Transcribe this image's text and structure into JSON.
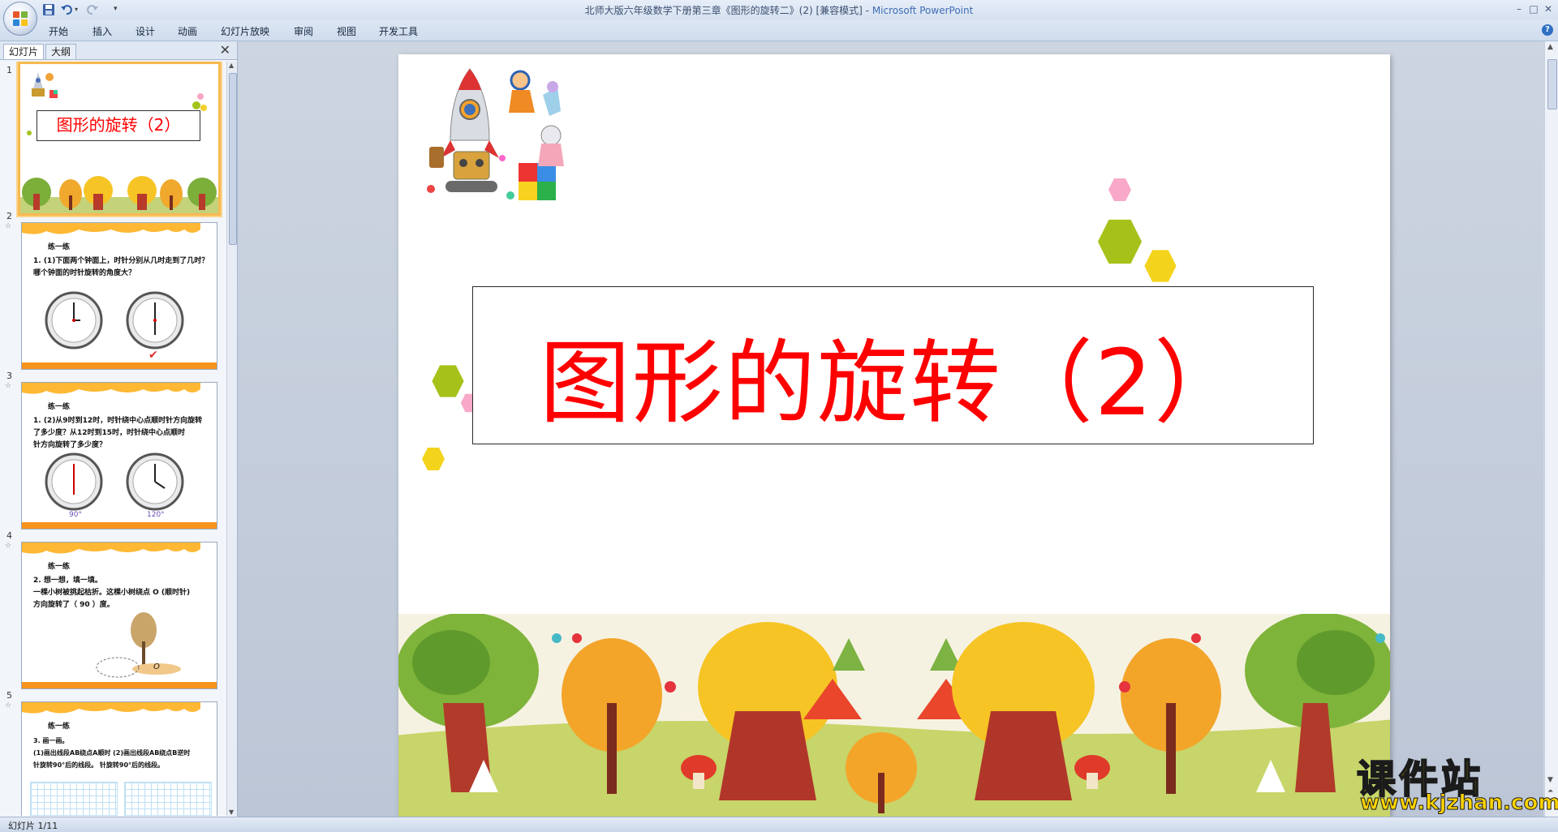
{
  "window": {
    "title": "北师大版六年级数学下册第三章《图形的旋转二》(2) [兼容模式] - ",
    "app_name": "Microsoft PowerPoint",
    "min": "–",
    "max": "□",
    "close": "✕"
  },
  "ribbon": {
    "tabs": [
      "开始",
      "插入",
      "设计",
      "动画",
      "幻灯片放映",
      "审阅",
      "视图",
      "开发工具"
    ],
    "help": "?"
  },
  "panel": {
    "tabs": [
      "幻灯片",
      "大纲"
    ],
    "close": "✕"
  },
  "thumbnails": [
    {
      "num": "1",
      "title": "图形的旋转（2）"
    },
    {
      "num": "2",
      "header": "练一练",
      "body": [
        "1. (1)下面两个钟面上，时针分别从几时走到了几时？",
        "    哪个钟面的时针旋转的角度大？"
      ],
      "check": "✔"
    },
    {
      "num": "3",
      "header": "练一练",
      "body": [
        "1. (2)从9时到12时，时针绕中心点顺时针方向旋转",
        "    了多少度？从12时到15时，时针绕中心点顺时",
        "    针方向旋转了多少度？"
      ],
      "deg1": "90°",
      "deg2": "120°"
    },
    {
      "num": "4",
      "header": "练一练",
      "body": [
        "2. 想一想，填一填。",
        "    一棵小树被挑起枯折。这棵小树绕点 O (顺时针)",
        "    方向旋转了（ 90 ）度。"
      ],
      "point": "O"
    },
    {
      "num": "5",
      "header": "练一练",
      "body": [
        "3. 画一画。",
        "(1)画出线段AB绕点A顺时    (2)画出线段AB绕点B逆时",
        "    针旋转90°后的线段。       针旋转90°后的线段。"
      ]
    }
  ],
  "slide": {
    "title": "图形的旋转（2）"
  },
  "status": {
    "text": "幻灯片 1/11"
  },
  "watermark": {
    "main": "课件站",
    "url": "www.kjzhan.com"
  },
  "colors": {
    "title_red": "#ff0000",
    "selection_orange": "#f7b950",
    "bar_orange": "#f7941d"
  }
}
